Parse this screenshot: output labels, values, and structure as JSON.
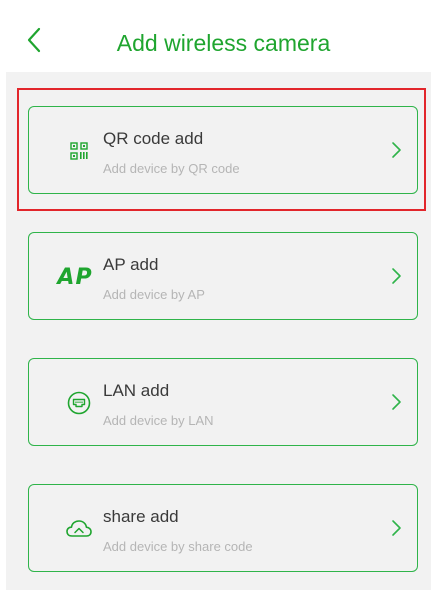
{
  "header": {
    "title": "Add wireless camera",
    "back_icon": "chevron-left-icon",
    "accent_color": "#1fa52f"
  },
  "options": [
    {
      "label": "QR code add",
      "subtitle": "Add device by QR code",
      "icon": "qr-code-icon",
      "highlighted": true
    },
    {
      "label": "AP add",
      "subtitle": "Add device by AP",
      "icon": "ap-icon",
      "icon_text": "AP"
    },
    {
      "label": "LAN add",
      "subtitle": "Add device by LAN",
      "icon": "lan-icon"
    },
    {
      "label": "share add",
      "subtitle": "Add device by share code",
      "icon": "cloud-share-icon"
    }
  ],
  "colors": {
    "card_border": "#2fb44a",
    "highlight_border": "#e2262b",
    "background": "#f2f2f2"
  }
}
